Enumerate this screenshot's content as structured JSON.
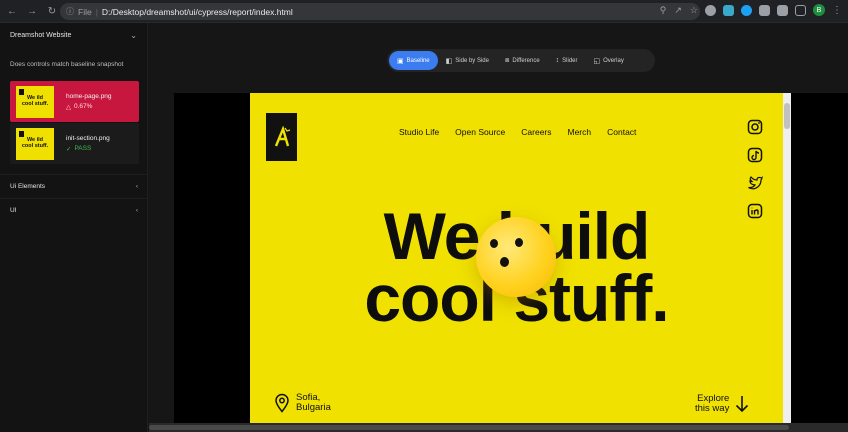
{
  "browser": {
    "file_label": "File",
    "url": "D:/Desktop/dreamshot/ui/cypress/report/index.html",
    "profile_initial": "B"
  },
  "sidebar": {
    "title": "Dreamshot Website",
    "test_description": "Does controls match baseline snapshot",
    "snapshots": [
      {
        "name": "home-page.png",
        "status": "0.67%",
        "thumb_line1": "We   ild",
        "thumb_line2": "cool stuff."
      },
      {
        "name": "init-section.png",
        "status": "PASS",
        "thumb_line1": "We   ild",
        "thumb_line2": "cool stuff."
      }
    ],
    "groups": [
      {
        "label": "Ui Elements"
      },
      {
        "label": "UI"
      }
    ]
  },
  "modes": [
    {
      "label": "Baseline",
      "icon": "image-icon"
    },
    {
      "label": "Side by Side",
      "icon": "split-icon"
    },
    {
      "label": "Difference",
      "icon": "difference-icon"
    },
    {
      "label": "Slider",
      "icon": "slider-icon"
    },
    {
      "label": "Overlay",
      "icon": "overlay-icon"
    }
  ],
  "site": {
    "nav": [
      "Studio Life",
      "Open Source",
      "Careers",
      "Merch",
      "Contact"
    ],
    "hero_line1": "We build",
    "hero_line2": "cool stuff.",
    "location_line1": "Sofia,",
    "location_line2": "Bulgaria",
    "explore_line1": "Explore",
    "explore_line2": "this way",
    "socials": [
      "instagram-icon",
      "tiktok-icon",
      "twitter-icon",
      "linkedin-icon"
    ]
  },
  "colors": {
    "site_bg": "#f0e100",
    "active_snapshot": "#c8173f",
    "mode_selected": "#3b7cf0",
    "pass": "#3fb950"
  }
}
